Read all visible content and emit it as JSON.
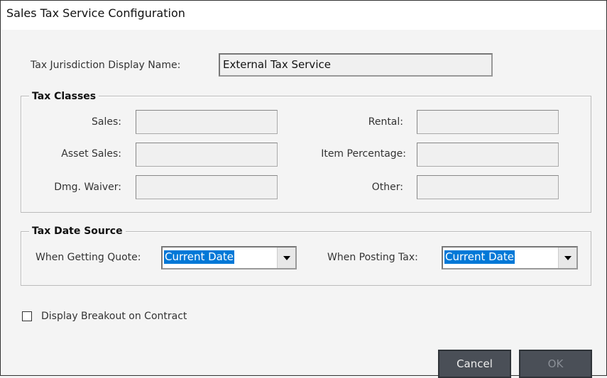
{
  "window": {
    "title": "Sales Tax Service Configuration"
  },
  "jurisdiction": {
    "label": "Tax Jurisdiction Display Name:",
    "value": "External Tax Service"
  },
  "tax_classes": {
    "legend": "Tax Classes",
    "fields": [
      {
        "label": "Sales:",
        "value": ""
      },
      {
        "label": "Rental:",
        "value": ""
      },
      {
        "label": "Asset Sales:",
        "value": ""
      },
      {
        "label": "Item Percentage:",
        "value": ""
      },
      {
        "label": "Dmg. Waiver:",
        "value": ""
      },
      {
        "label": "Other:",
        "value": ""
      }
    ]
  },
  "tax_date_source": {
    "legend": "Tax Date Source",
    "quote_label": "When Getting Quote:",
    "quote_value": "Current Date",
    "posting_label": "When Posting Tax:",
    "posting_value": "Current Date"
  },
  "breakout": {
    "label": "Display Breakout on Contract",
    "checked": false
  },
  "buttons": {
    "cancel": "Cancel",
    "ok": "OK"
  }
}
